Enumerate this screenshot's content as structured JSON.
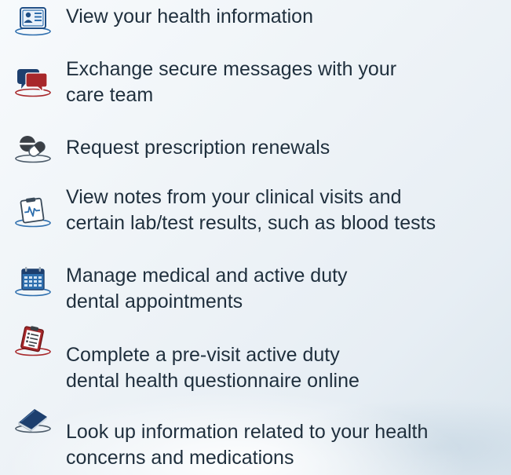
{
  "features": [
    {
      "icon": "profile-card-icon",
      "lines": [
        "View your health information"
      ]
    },
    {
      "icon": "chat-bubble-icon",
      "lines": [
        "Exchange secure messages with your",
        "care team"
      ]
    },
    {
      "icon": "pill-capsule-icon",
      "lines": [
        "Request prescription renewals"
      ]
    },
    {
      "icon": "clipboard-chart-icon",
      "lines": [
        "View notes from your clinical visits and",
        "certain lab/test results, such as blood tests"
      ]
    },
    {
      "icon": "calendar-icon",
      "lines": [
        "Manage medical and active duty",
        "dental appointments"
      ]
    },
    {
      "icon": "questionnaire-clipboard-icon",
      "lines": [
        "Complete a pre-visit active duty",
        "dental health questionnaire online"
      ]
    },
    {
      "icon": "book-icon",
      "lines": [
        "Look up information related to your health",
        "concerns and medications"
      ]
    }
  ],
  "colors": {
    "text": "#1f2f3d",
    "icon_blue": "#2f6fae",
    "icon_red": "#a8282b",
    "icon_outline": "#4d5c6a"
  }
}
